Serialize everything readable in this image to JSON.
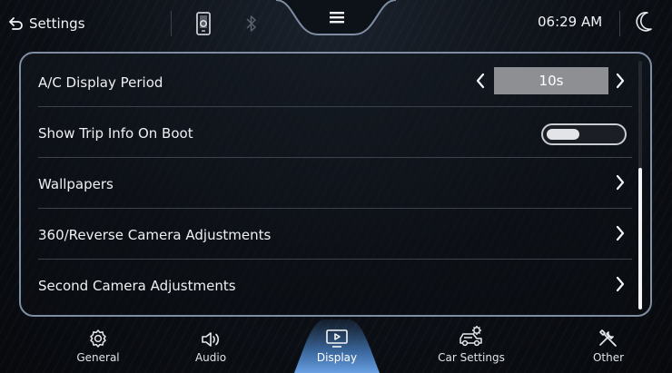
{
  "topbar": {
    "back_label": "Settings",
    "time": "06:29 AM",
    "icons": [
      "back-arrow-icon",
      "phone-link-icon",
      "bluetooth-icon",
      "menu-icon",
      "moon-icon"
    ]
  },
  "settings": {
    "rows": [
      {
        "label": "A/C Display Period",
        "control": "stepper",
        "value": "10s"
      },
      {
        "label": "Show Trip Info On Boot",
        "control": "toggle",
        "on": false
      },
      {
        "label": "Wallpapers",
        "control": "chevron"
      },
      {
        "label": "360/Reverse Camera Adjustments",
        "control": "chevron"
      },
      {
        "label": "Second Camera Adjustments",
        "control": "chevron"
      }
    ]
  },
  "nav": {
    "items": [
      {
        "label": "General",
        "icon": "gear-icon"
      },
      {
        "label": "Audio",
        "icon": "speaker-icon"
      },
      {
        "label": "Display",
        "icon": "display-icon",
        "active": true
      },
      {
        "label": "Car Settings",
        "icon": "car-gear-icon"
      },
      {
        "label": "Other",
        "icon": "tools-icon"
      }
    ]
  },
  "colors": {
    "accent": "#6fa8ee",
    "panel_border": "#7e8da2",
    "stepper_bg": "#8d8f92"
  }
}
